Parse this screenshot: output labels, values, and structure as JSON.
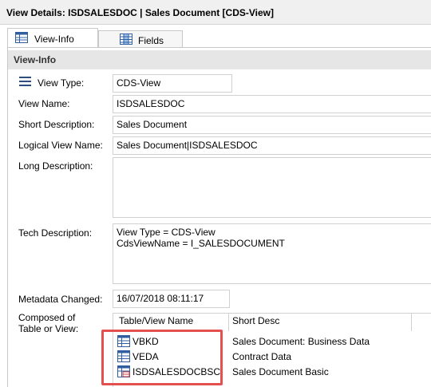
{
  "window": {
    "title": "View Details: ISDSALESDOC | Sales Document [CDS-View]"
  },
  "tabs": [
    {
      "label": "View-Info",
      "icon": "table-icon",
      "active": true
    },
    {
      "label": "Fields",
      "icon": "columns-icon",
      "active": false
    }
  ],
  "section": {
    "title": "View-Info"
  },
  "form": {
    "view_type_label": "View Type:",
    "view_type_value": "CDS-View",
    "view_name_label": "View Name:",
    "view_name_value": "ISDSALESDOC",
    "short_desc_label": "Short Description:",
    "short_desc_value": "Sales Document",
    "logical_name_label": "Logical View Name:",
    "logical_name_value": "Sales Document|ISDSALESDOC",
    "long_desc_label": "Long Description:",
    "long_desc_value": "",
    "tech_desc_label": "Tech Description:",
    "tech_desc_value": "View Type = CDS-View\nCdsViewName = I_SALESDOCUMENT",
    "metadata_label": "Metadata Changed:",
    "metadata_value": "16/07/2018 08:11:17",
    "composed_label": "Composed of\nTable or View:"
  },
  "composed_table": {
    "headers": [
      "Table/View Name",
      "Short Desc"
    ],
    "rows": [
      {
        "name": "VBKD",
        "desc": "Sales Document: Business Data",
        "icon": "table-icon"
      },
      {
        "name": "VEDA",
        "desc": "Contract Data",
        "icon": "table-icon"
      },
      {
        "name": "ISDSALESDOCBSC",
        "desc": "Sales Document Basic",
        "icon": "view-table-icon"
      }
    ]
  },
  "colors": {
    "highlight": "#e45050",
    "icon_blue": "#2f5fa0",
    "section_bg": "#e6e6e6"
  }
}
